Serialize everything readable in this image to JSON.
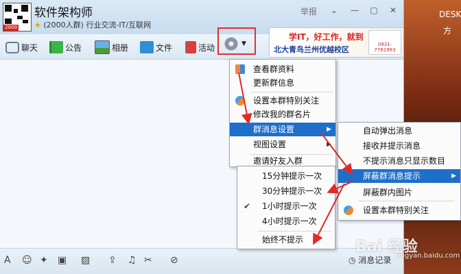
{
  "window": {
    "group_name": "软件架构师",
    "group_meta": "(2000人群) 行业交流-IT/互联网",
    "report_label": "举报",
    "qr_badge": "2000"
  },
  "desktop": {
    "label": "DESK",
    "label2": "方"
  },
  "toolbar": {
    "tabs": [
      {
        "label": "聊天",
        "icon": "chat-bubble-icon"
      },
      {
        "label": "公告",
        "icon": "flag-icon"
      },
      {
        "label": "相册",
        "icon": "photo-icon"
      },
      {
        "label": "文件",
        "icon": "folder-icon"
      },
      {
        "label": "活动",
        "icon": "red-flag-icon"
      }
    ],
    "settings_icon": "gear-icon"
  },
  "ad": {
    "line1": "学IT，好工作，就到",
    "line2": "北大青鸟兰州优越校区",
    "phone": "0931-7761993"
  },
  "menu_main": [
    {
      "label": "查看群资料"
    },
    {
      "label": "更新群信息"
    },
    {
      "label": "设置本群特别关注"
    },
    {
      "label": "修改我的群名片"
    },
    {
      "label": "群消息设置",
      "highlighted": true,
      "submenu": true
    },
    {
      "label": "视图设置",
      "submenu": true
    },
    {
      "label": "邀请好友入群"
    }
  ],
  "menu_msg": [
    {
      "label": "自动弹出消息"
    },
    {
      "label": "接收并提示消息"
    },
    {
      "label": "不提示消息只显示数目"
    },
    {
      "label": "屏蔽群消息提示",
      "highlighted": true,
      "submenu": true
    },
    {
      "label": "屏蔽群内图片"
    },
    {
      "label": "设置本群特别关注"
    }
  ],
  "menu_block": [
    {
      "label": "15分钟提示一次"
    },
    {
      "label": "30分钟提示一次"
    },
    {
      "label": "1小时提示一次",
      "checked": true
    },
    {
      "label": "4小时提示一次"
    },
    {
      "label": "始终不提示"
    }
  ],
  "bottom": {
    "msg_log": "消息记录",
    "icons": [
      "font-icon",
      "emoji-icon",
      "magic-icon",
      "shake-icon",
      "image-icon",
      "upload-icon",
      "music-icon",
      "scissors-icon",
      "block-icon"
    ]
  },
  "watermark": {
    "brand": "Bai 经验",
    "sub": "jingyan.baidu.com"
  },
  "colors": {
    "highlight": "#1e6fc9",
    "red_frame": "#e03030"
  }
}
